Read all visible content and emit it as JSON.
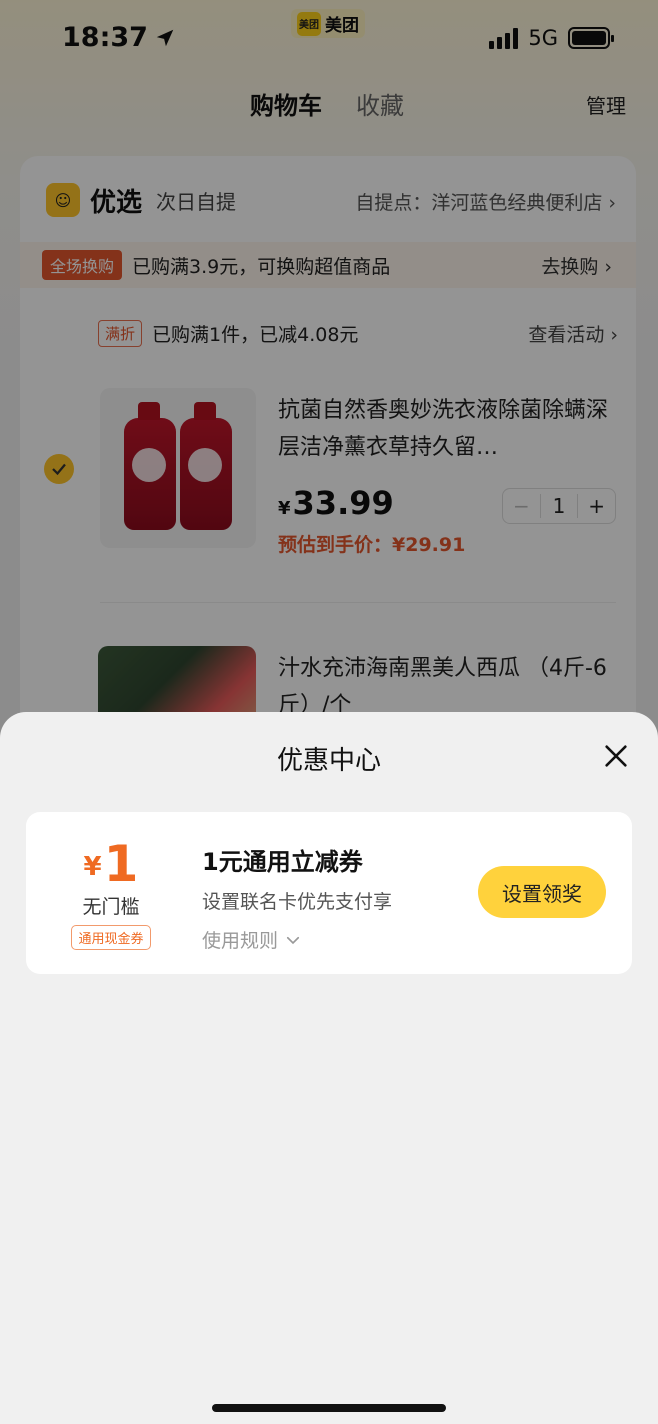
{
  "status_bar": {
    "time": "18:37",
    "app_label": "美团",
    "app_logo_text": "美团",
    "network": "5G"
  },
  "nav": {
    "tab_cart": "购物车",
    "tab_favorites": "收藏",
    "manage": "管理"
  },
  "store": {
    "name": "优选",
    "mode": "次日自提",
    "pickup": "自提点：洋河蓝色经典便利店 ›"
  },
  "promo": {
    "tag": "全场换购",
    "text": "已购满3.9元，可换购超值商品",
    "link": "去换购 ›"
  },
  "discount": {
    "tag": "满折",
    "text": "已购满1件，已减4.08元",
    "link": "查看活动 ›"
  },
  "items": [
    {
      "title": "抗菌自然香奥妙洗衣液除菌除螨深层洁净薰衣草持久留…",
      "price_symbol": "¥",
      "price": "33.99",
      "estimate": "预估到手价：¥29.91",
      "quantity": "1",
      "minus": "−",
      "plus": "+"
    },
    {
      "title": "汁水充沛海南黑美人西瓜 （4斤-6斤）/个"
    }
  ],
  "sheet": {
    "title": "优惠中心",
    "coupon": {
      "currency": "¥",
      "amount": "1",
      "threshold": "无门槛",
      "type": "通用现金券",
      "name": "1元通用立减券",
      "desc": "设置联名卡优先支付享",
      "rules": "使用规则",
      "button": "设置领奖"
    }
  },
  "icons": {
    "location": "location-arrow-icon",
    "close": "close-icon",
    "check": "check-icon",
    "chevron": "chevron-down-icon"
  },
  "colors": {
    "accent_yellow": "#ffd23c",
    "coupon_orange": "#ef6a22",
    "promo_red": "#e4572e"
  }
}
